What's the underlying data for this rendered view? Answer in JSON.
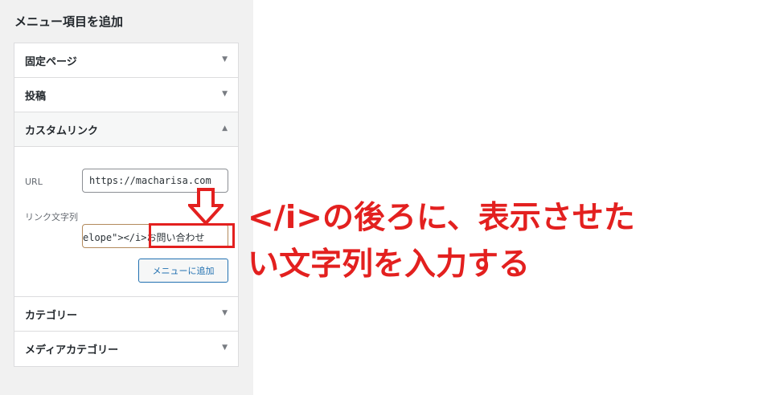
{
  "panel": {
    "title": "メニュー項目を追加",
    "sections": {
      "pages": "固定ページ",
      "posts": "投稿",
      "custom_links": "カスタムリンク",
      "categories": "カテゴリー",
      "media_categories": "メディアカテゴリー"
    },
    "arrow_down": "▼",
    "arrow_up": "▲",
    "custom_link": {
      "url_label": "URL",
      "url_value": "https://macharisa.com",
      "text_label": "リンク文字列",
      "text_value_before": "elope\"></i>",
      "text_value_after": "お問い合わせ",
      "add_button": "メニューに追加"
    }
  },
  "annotation": {
    "line1": "</i>の後ろに、表示させた",
    "line2": "い文字列を入力する",
    "color": "#e3201f"
  }
}
